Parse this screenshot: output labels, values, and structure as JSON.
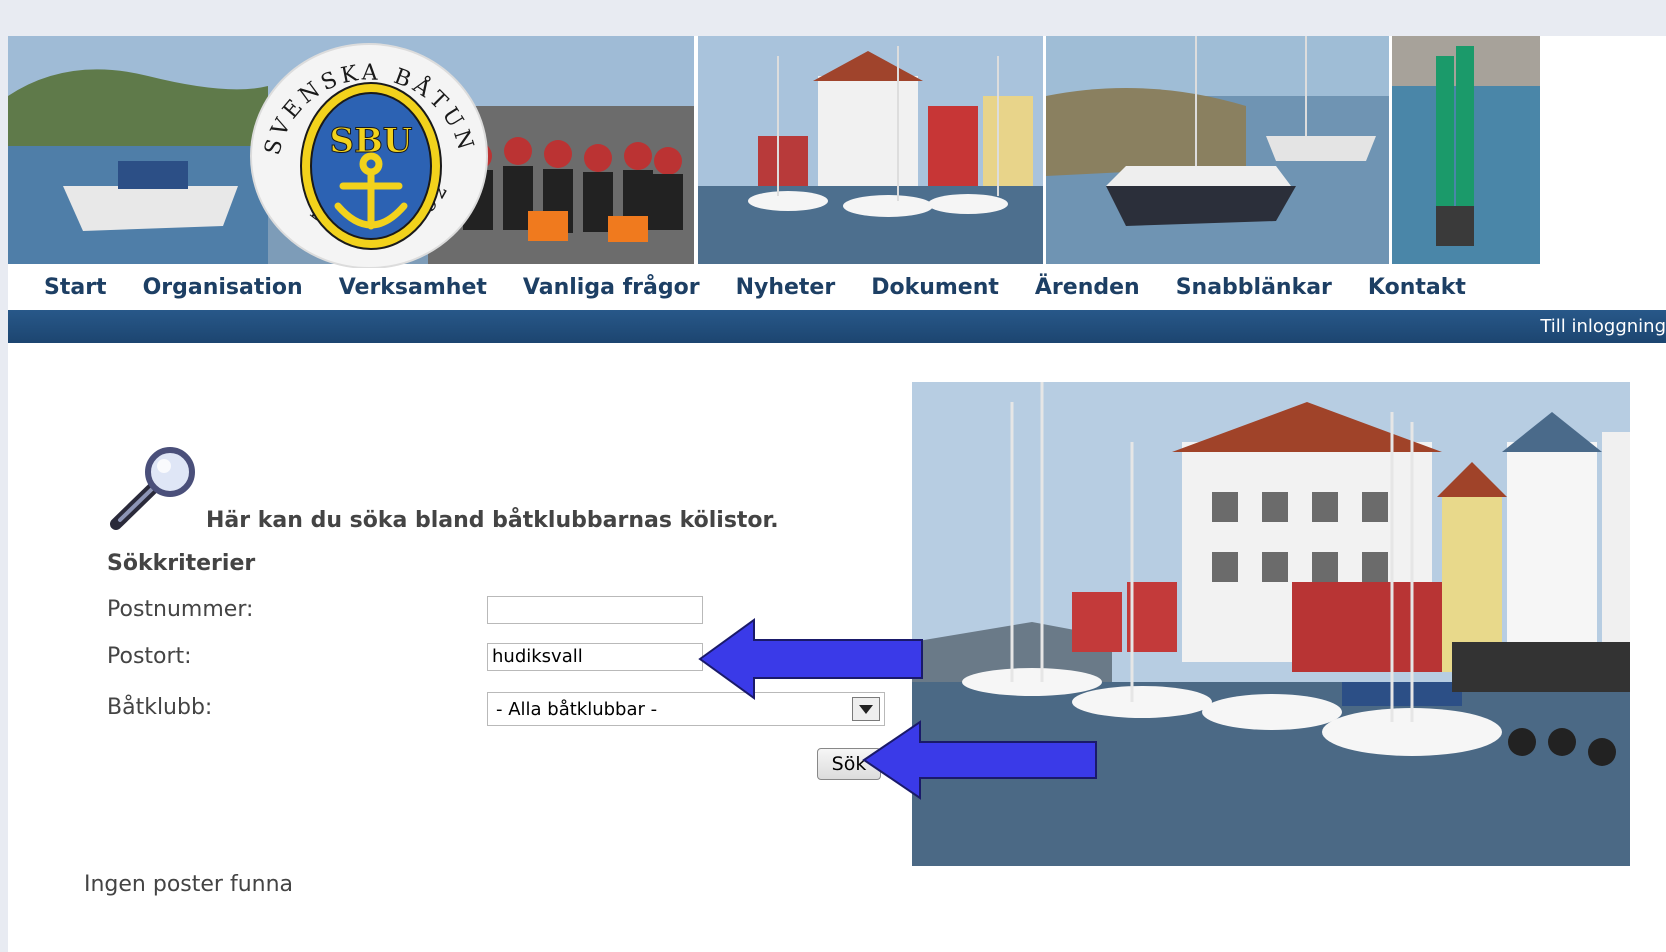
{
  "nav": {
    "items": [
      "Start",
      "Organisation",
      "Verksamhet",
      "Vanliga frågor",
      "Nyheter",
      "Dokument",
      "Ärenden",
      "Snabblänkar",
      "Kontakt"
    ]
  },
  "header": {
    "login_link": "Till inloggning"
  },
  "logo": {
    "text_top": "SVENSKA BÅTUNIONEN",
    "text_bottom": "BILDAD 1928",
    "monogram": "SBU"
  },
  "search": {
    "intro": "Här kan du söka bland båtklubbarnas kölistor.",
    "criteria_title": "Sökkriterier",
    "postnummer_label": "Postnummer:",
    "postnummer_value": "",
    "postort_label": "Postort:",
    "postort_value": "hudiksvall",
    "batklubb_label": "Båtklubb:",
    "batklubb_selected": "- Alla båtklubbar -",
    "submit_label": "Sök"
  },
  "results": {
    "message": "Ingen poster funna"
  },
  "colors": {
    "nav_text": "#1d3f64",
    "bar": "#1f4a77",
    "arrow": "#3a3ae8"
  },
  "icons": [
    "magnifier-icon",
    "dropdown-arrow-icon",
    "arrow-pointer-icon"
  ]
}
